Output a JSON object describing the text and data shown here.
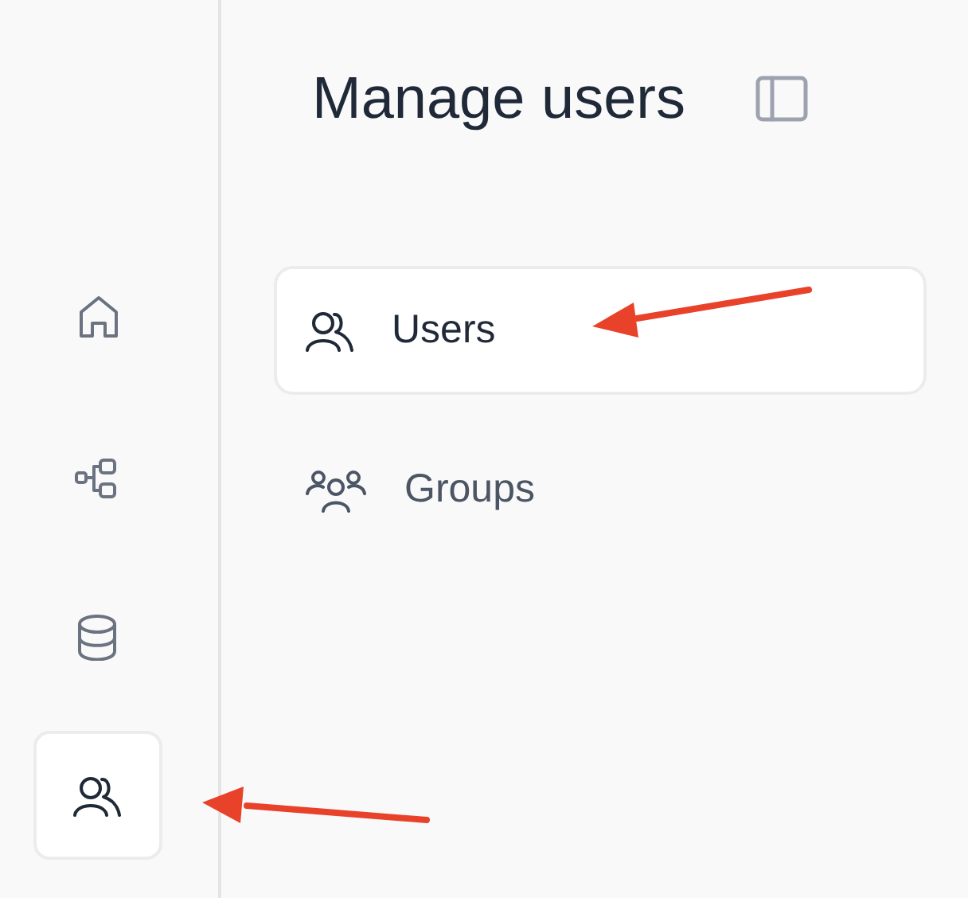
{
  "rail": {
    "items": [
      {
        "selected": false
      },
      {
        "selected": false
      },
      {
        "selected": false
      },
      {
        "selected": true
      }
    ]
  },
  "header": {
    "title": "Manage users"
  },
  "nav": {
    "items": [
      {
        "label": "Users",
        "selected": true
      },
      {
        "label": "Groups",
        "selected": false
      }
    ]
  }
}
